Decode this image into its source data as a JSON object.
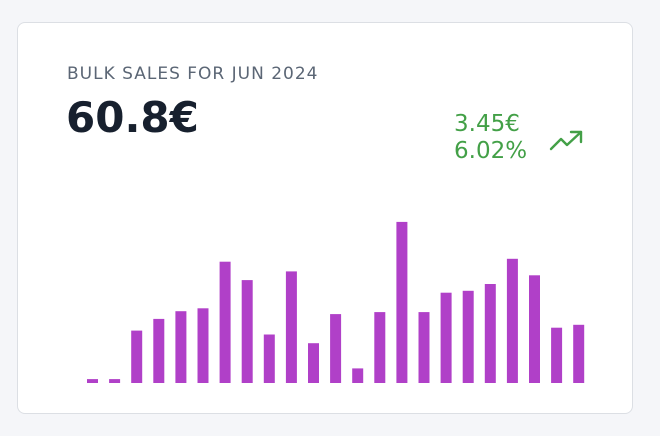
{
  "card": {
    "title": "BULK SALES FOR JUN 2024",
    "value": "60.8€",
    "delta_amount": "3.45€",
    "delta_percent": "6.02%",
    "trend_icon": "trending-up-icon",
    "trend_color": "#43a047"
  },
  "chart_data": {
    "type": "bar",
    "x": [
      1,
      2,
      3,
      4,
      5,
      6,
      7,
      8,
      9,
      10,
      11,
      12,
      13,
      14,
      15,
      16,
      17,
      18,
      19,
      20,
      21,
      22,
      23,
      24,
      25,
      26,
      27,
      28,
      29,
      30
    ],
    "values": [
      0.2,
      0.2,
      2.7,
      3.3,
      3.7,
      3.85,
      6.25,
      5.3,
      2.5,
      5.75,
      2.05,
      3.55,
      0.75,
      3.65,
      8.3,
      3.65,
      4.65,
      4.75,
      5.1,
      6.4,
      5.55,
      2.85,
      3.0,
      0,
      0,
      0,
      0,
      0,
      0,
      0
    ],
    "ylim": [
      0,
      8.5
    ],
    "bar_color": "#b040c8",
    "grid": false,
    "title": "",
    "xlabel": "",
    "ylabel": ""
  }
}
